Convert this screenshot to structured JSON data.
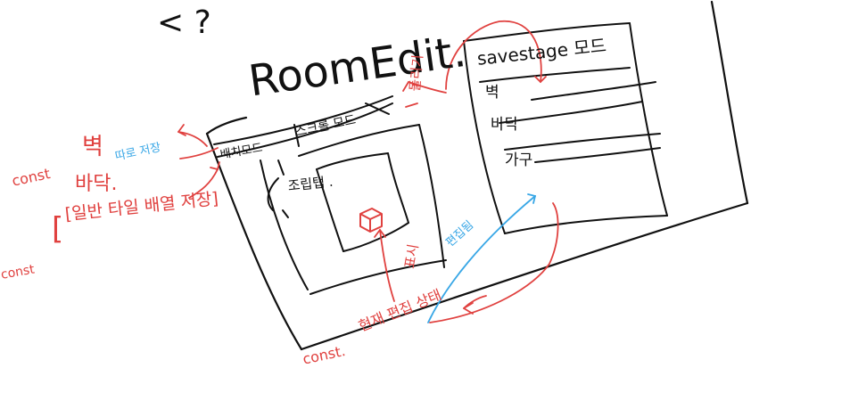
{
  "texts": {
    "corner": "< ?",
    "title": "RoomEdit.",
    "tab_left": "배치모드",
    "tab_right": "스크롤 모드",
    "assemble": "조립탭 .",
    "storage_title": "savestage 모드",
    "item_wall": "벽",
    "item_floor": "바닥",
    "item_furniture": "가구",
    "note_wall": "벽",
    "note_separate_save": "따로 저장",
    "note_floor": "바닥.",
    "note_const1": "const",
    "note_general_array": "[일반 타일 배열 저장]",
    "note_const2": "const",
    "note_rotate": "돌리기",
    "note_show": "표시",
    "note_edit_done": "편집됨",
    "note_const3": "const.",
    "note_current_edit": "현재 편집 상태",
    "bracket_open": "[",
    "bracket_close": "]"
  },
  "colors": {
    "ink": "#111111",
    "red": "#e0413f",
    "blue": "#39a7e6"
  }
}
